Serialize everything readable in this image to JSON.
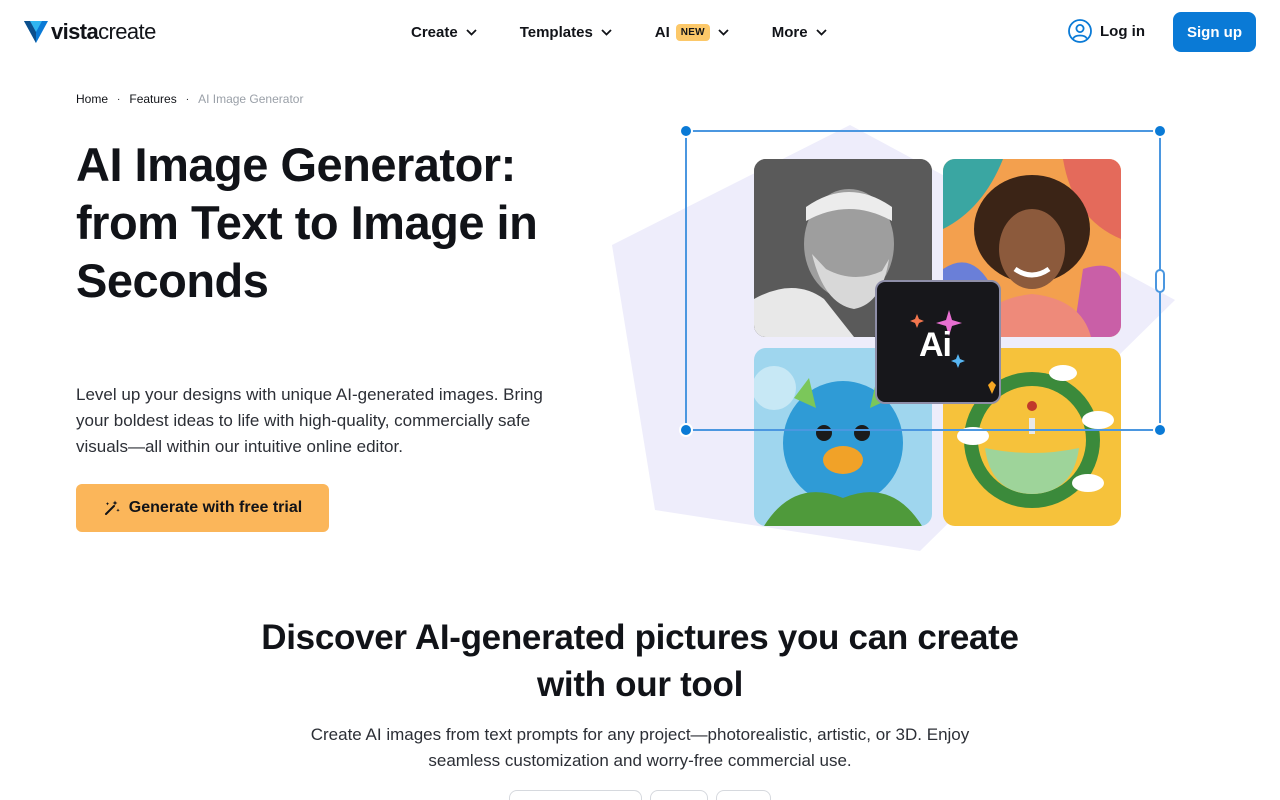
{
  "header": {
    "logo": {
      "brand_bold": "vista",
      "brand_light": "create"
    },
    "nav": [
      {
        "label": "Create",
        "icon": "chevron-down-icon"
      },
      {
        "label": "Templates",
        "icon": "chevron-down-icon"
      },
      {
        "label": "AI",
        "badge": "NEW",
        "icon": "chevron-down-icon"
      },
      {
        "label": "More",
        "icon": "chevron-down-icon"
      }
    ],
    "login_label": "Log in",
    "signup_label": "Sign up"
  },
  "breadcrumb": {
    "items": [
      "Home",
      "Features"
    ],
    "current": "AI Image Generator",
    "separator": "·"
  },
  "hero": {
    "title": "AI Image Generator: from Text to Image in Seconds",
    "description": "Level up your designs with unique AI-generated images. Bring your boldest ideas to life with high-quality, commercially safe visuals—all within our intuitive online editor.",
    "cta_label": "Generate with free trial",
    "ai_tile_text": "Ai"
  },
  "section": {
    "title": "Discover AI-generated pictures you can create with our tool",
    "description": "Create AI images from text prompts for any project—photorealistic, artistic, or 3D. Enjoy seamless customization and worry-free commercial use."
  },
  "colors": {
    "primary": "#0a7ad6",
    "cta": "#fbb65a",
    "badge": "#fcc869",
    "art_background": "#eeedfb"
  }
}
